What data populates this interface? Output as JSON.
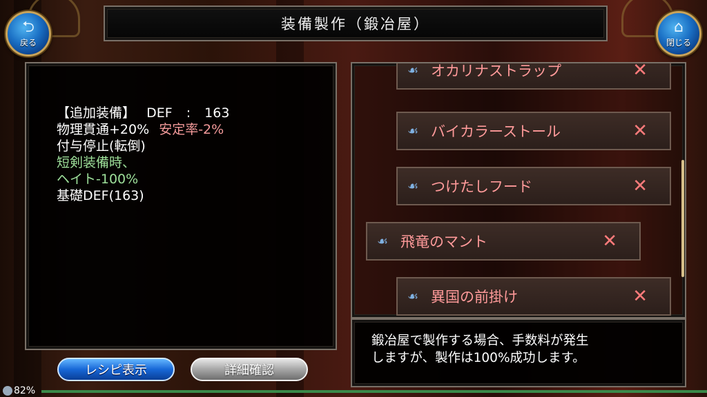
{
  "header": {
    "title": "装備製作（鍛冶屋）",
    "back_label": "戻る",
    "close_label": "閉じる"
  },
  "description": {
    "line1_label": "【追加装備】",
    "line1_stat": "DEF",
    "line1_sep": ":",
    "line1_value": "163",
    "line2_a": "物理貫通+20%",
    "line2_b": "安定率-2%",
    "line3": "付与停止(転倒)",
    "line4": "短剣装備時、",
    "line5": "ヘイト-100%",
    "line6": "基礎DEF(163)"
  },
  "buttons": {
    "recipe": "レシピ表示",
    "details": "詳細確認"
  },
  "items": [
    {
      "name": "オカリナストラップ",
      "mark": "✕"
    },
    {
      "name": "バイカラーストール",
      "mark": "✕"
    },
    {
      "name": "つけたしフード",
      "mark": "✕"
    },
    {
      "name": "飛竜のマント",
      "mark": "✕"
    },
    {
      "name": "異国の前掛け",
      "mark": "✕"
    }
  ],
  "info": {
    "line1": "鍛冶屋で製作する場合、手数料が発生",
    "line2": "しますが、製作は100%成功します。"
  },
  "status": {
    "percent": "82%"
  },
  "colors": {
    "item_text": "#ff9a9a",
    "highlight_pink": "#f39a9a",
    "highlight_green": "#9ee09a",
    "button_blue": "#1767d6"
  }
}
